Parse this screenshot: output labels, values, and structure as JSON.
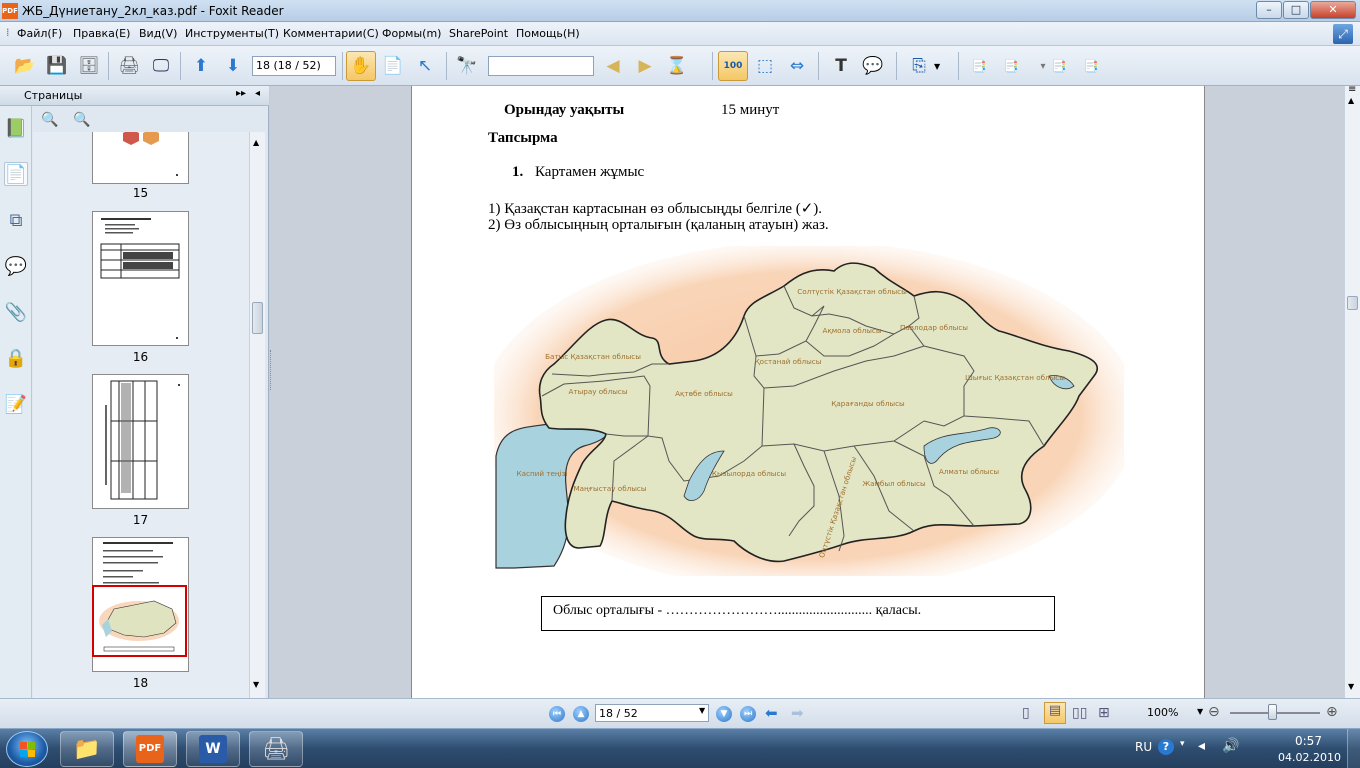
{
  "window": {
    "title": "ЖБ_Дүниетану_2кл_каз.pdf - Foxit Reader",
    "app_icon_text": "PDF",
    "min": "–",
    "max": "□",
    "close": "✕"
  },
  "menu": [
    "Файл(F)",
    "Правка(E)",
    "Вид(V)",
    "Инструменты(T)",
    "Комментарии(C)",
    "Формы(m)",
    "SharePoint",
    "Помощь(H)"
  ],
  "toolbar": {
    "page_field": "18 (18 / 52)",
    "search_value": ""
  },
  "sidebar": {
    "title": "Страницы",
    "thumb_numbers": [
      "15",
      "16",
      "17",
      "18"
    ]
  },
  "document": {
    "time_label": "Орындау уақыты",
    "time_value": "15 минут",
    "task_heading": "Тапсырма",
    "item_number": "1.",
    "item_title": "Картамен жұмыс",
    "instruction_1": "1) Қазақстан картасынан өз облысыңды белгіле (✓).",
    "instruction_2": "2) Өз облысыңның орталығын (қаланың атауын) жаз.",
    "map_labels": {
      "north": "Солтүстік Қазақстан облысы",
      "akmola": "Ақмола облысы",
      "pavlodar": "Павлодар облысы",
      "west": "Батыс Қазақстан облысы",
      "kostanay": "Қостанай облысы",
      "atyrau": "Атырау облысы",
      "aktobe": "Ақтөбе облысы",
      "karaganda": "Қарағанды облысы",
      "east": "Шығыс Қазақстан облысы",
      "caspian": "Каспий теңізі",
      "mangystau": "Маңғыстау облысы",
      "kyzylorda": "Қызылорда облысы",
      "zhambyl": "Жамбыл облысы",
      "almaty": "Алматы облысы",
      "south": "Оңтүстік Қазақстан облысы"
    },
    "answer_box": "Облыс орталығы -  ……………………........................... қаласы."
  },
  "status": {
    "page_field": "18 / 52",
    "zoom": "100%"
  },
  "taskbar": {
    "lang": "RU",
    "time": "0:57",
    "date": "04.02.2010"
  },
  "colors": {
    "map_land": "#e2e6c4",
    "map_water": "#a8d2de",
    "map_glow": "#f7c7a2",
    "label": "#a07030",
    "selection": "#d40000"
  }
}
